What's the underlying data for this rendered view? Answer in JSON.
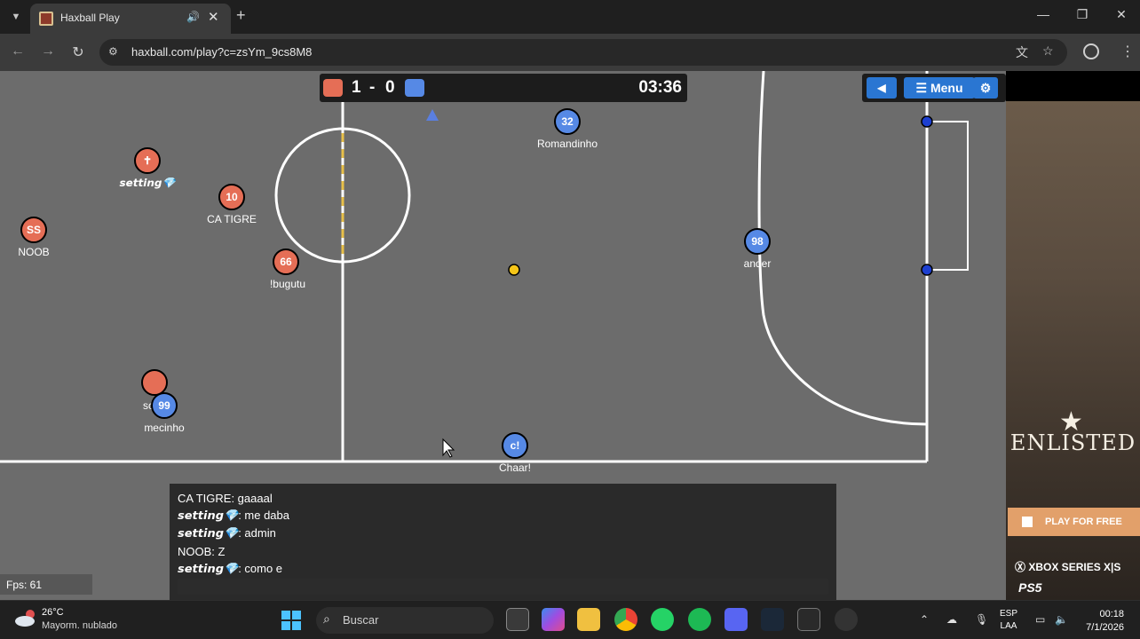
{
  "browser": {
    "tab_title": "Haxball Play",
    "url": "haxball.com/play?c=zsYm_9cs8M8"
  },
  "game": {
    "score_red": "1",
    "score_sep": "-",
    "score_blue": "0",
    "timer": "03:36",
    "menu_label": "Menu",
    "fps_label": "Fps: 61",
    "colors": {
      "red": "#e56e56",
      "blue": "#5689e5",
      "field": "#6c6c6c",
      "ball": "#f5c518"
    },
    "players": [
      {
        "team": "red",
        "avatar": "✝",
        "name": "𝙨𝙚𝙩𝙩𝙞𝙣𝙜💎"
      },
      {
        "team": "red",
        "avatar": "10",
        "name": "CA TIGRE"
      },
      {
        "team": "red",
        "avatar": "SS",
        "name": "NOOB"
      },
      {
        "team": "red",
        "avatar": "66",
        "name": "!bugutu"
      },
      {
        "team": "red",
        "avatar": "",
        "name": "sc"
      },
      {
        "team": "blue",
        "avatar": "99",
        "name": "mecinho"
      },
      {
        "team": "blue",
        "avatar": "32",
        "name": "Romandinho"
      },
      {
        "team": "blue",
        "avatar": "98",
        "name": "ander"
      },
      {
        "team": "blue",
        "avatar": "c!",
        "name": "Chaar!"
      }
    ],
    "chat": [
      {
        "nick": "CA TIGRE",
        "text": ": gaaaal",
        "styled": false
      },
      {
        "nick": "𝙨𝙚𝙩𝙩𝙞𝙣𝙜💎",
        "text": ": me daba",
        "styled": true
      },
      {
        "nick": "𝙨𝙚𝙩𝙩𝙞𝙣𝙜💎",
        "text": ": admin",
        "styled": true
      },
      {
        "nick": "NOOB",
        "text": ": Z",
        "styled": false
      },
      {
        "nick": "𝙨𝙚𝙩𝙩𝙞𝙣𝙜💎",
        "text": ": como e",
        "styled": true
      }
    ]
  },
  "ad": {
    "logo": "ENLISTED",
    "cta": "PLAY FOR FREE",
    "platform1": "XBOX SERIES X|S",
    "platform2": "PS5"
  },
  "taskbar": {
    "weather_temp": "26°C",
    "weather_desc": "Mayorm. nublado",
    "search_label": "Buscar",
    "lang_1": "ESP",
    "lang_2": "LAA",
    "time": "00:18",
    "date": "7/1/2026"
  }
}
